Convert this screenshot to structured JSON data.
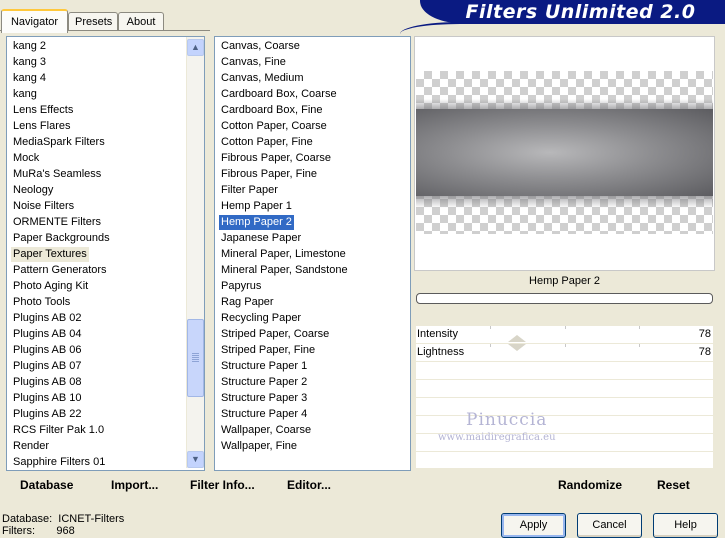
{
  "tabs": [
    {
      "label": "Navigator"
    },
    {
      "label": "Presets"
    },
    {
      "label": "About"
    }
  ],
  "app_title": "Filters Unlimited 2.0",
  "categories": [
    "kang 2",
    "kang 3",
    "kang 4",
    "kang",
    "Lens Effects",
    "Lens Flares",
    "MediaSpark Filters",
    "Mock",
    "MuRa's Seamless",
    "Neology",
    "Noise Filters",
    "ORMENTE Filters",
    "Paper Backgrounds",
    "Paper Textures",
    "Pattern Generators",
    "Photo Aging Kit",
    "Photo Tools",
    "Plugins AB 02",
    "Plugins AB 04",
    "Plugins AB 06",
    "Plugins AB 07",
    "Plugins AB 08",
    "Plugins AB 10",
    "Plugins AB 22",
    "RCS Filter Pak 1.0",
    "Render",
    "Sapphire Filters 01"
  ],
  "selected_category": "Paper Textures",
  "filters": [
    "Canvas, Coarse",
    "Canvas, Fine",
    "Canvas, Medium",
    "Cardboard Box, Coarse",
    "Cardboard Box, Fine",
    "Cotton Paper, Coarse",
    "Cotton Paper, Fine",
    "Fibrous Paper, Coarse",
    "Fibrous Paper, Fine",
    "Filter Paper",
    "Hemp Paper 1",
    "Hemp Paper 2",
    "Japanese Paper",
    "Mineral Paper, Limestone",
    "Mineral Paper, Sandstone",
    "Papyrus",
    "Rag Paper",
    "Recycling Paper",
    "Striped Paper, Coarse",
    "Striped Paper, Fine",
    "Structure Paper 1",
    "Structure Paper 2",
    "Structure Paper 3",
    "Structure Paper 4",
    "Wallpaper, Coarse",
    "Wallpaper, Fine"
  ],
  "selected_filter": "Hemp Paper 2",
  "preview": {
    "filter_name": "Hemp Paper 2"
  },
  "sliders": [
    {
      "label": "Intensity",
      "value": "78",
      "level_fraction": 0.34
    },
    {
      "label": "Lightness",
      "value": "78",
      "level_fraction": 0.34
    }
  ],
  "watermark": {
    "name": "Pinuccia",
    "url": "www.maidiregrafica.eu"
  },
  "links": {
    "database": "Database",
    "import": "Import...",
    "filter_info": "Filter Info...",
    "editor": "Editor...",
    "randomize": "Randomize",
    "reset": "Reset"
  },
  "status": {
    "database_label": "Database:",
    "database_value": "ICNET-Filters",
    "filters_label": "Filters:",
    "filters_value": "968"
  },
  "buttons": {
    "apply": "Apply",
    "cancel": "Cancel",
    "help": "Help"
  },
  "colors": {
    "banner": "#0a1a82",
    "selection": "#316ac5",
    "background": "#ece9d8"
  }
}
